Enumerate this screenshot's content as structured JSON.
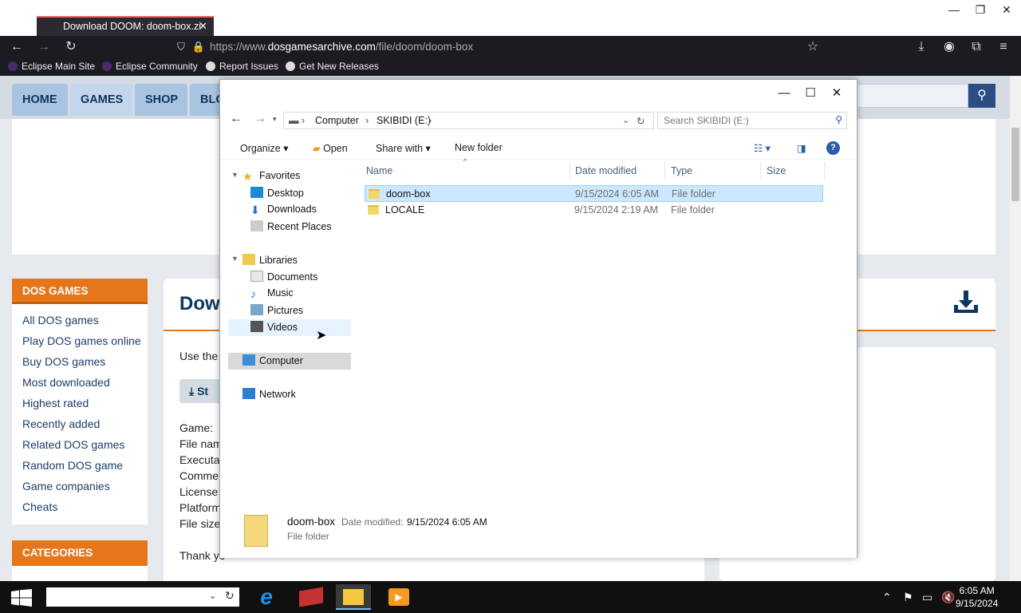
{
  "browser": {
    "tab_title": "Download DOOM: doom-box.zi",
    "url_prefix": "https://www.",
    "url_domain": "dosgamesarchive.com",
    "url_path": "/file/doom/doom-box",
    "bookmarks": [
      "Eclipse Main Site",
      "Eclipse Community",
      "Report Issues",
      "Get New Releases"
    ]
  },
  "site": {
    "nav": [
      "HOME",
      "GAMES",
      "SHOP",
      "BLO"
    ],
    "sidebar_title": "DOS GAMES",
    "sidebar_items": [
      "All DOS games",
      "Play DOS games online",
      "Buy DOS games",
      "Most downloaded",
      "Highest rated",
      "Recently added",
      "Related DOS games",
      "Random DOS game",
      "Game companies",
      "Cheats"
    ],
    "categories_title": "CATEGORIES",
    "main_title": "Dow",
    "body_lines": [
      "Use the",
      "Game:",
      "File nam",
      "Executa",
      "Comme",
      "License",
      "Platform",
      "File size"
    ],
    "start_btn": "St",
    "thank_you": "Thank yo"
  },
  "explorer": {
    "breadcrumb": [
      "Computer",
      "SKIBIDI (E:)"
    ],
    "search_placeholder": "Search SKIBIDI (E:)",
    "toolbar": {
      "organize": "Organize",
      "open": "Open",
      "share": "Share with",
      "new_folder": "New folder"
    },
    "tree": {
      "favorites": "Favorites",
      "fav_items": [
        "Desktop",
        "Downloads",
        "Recent Places"
      ],
      "libraries": "Libraries",
      "lib_items": [
        "Documents",
        "Music",
        "Pictures",
        "Videos"
      ],
      "computer": "Computer",
      "network": "Network"
    },
    "columns": [
      "Name",
      "Date modified",
      "Type",
      "Size"
    ],
    "files": [
      {
        "name": "doom-box",
        "date": "9/15/2024 6:05 AM",
        "type": "File folder",
        "size": ""
      },
      {
        "name": "LOCALE",
        "date": "9/15/2024 2:19 AM",
        "type": "File folder",
        "size": ""
      }
    ],
    "details": {
      "name": "doom-box",
      "date_label": "Date modified:",
      "date": "9/15/2024 6:05 AM",
      "type": "File folder"
    }
  },
  "taskbar": {
    "time": "6:05 AM",
    "date": "9/15/2024"
  }
}
